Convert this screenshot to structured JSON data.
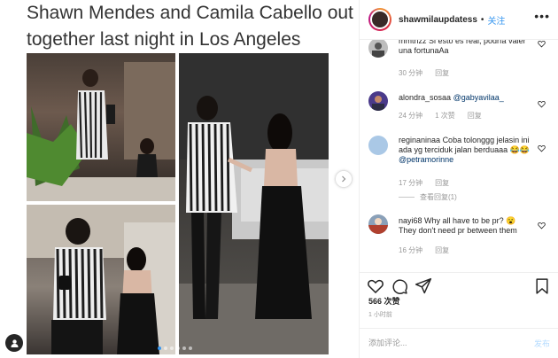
{
  "headline": "Shawn Mendes and Camila Cabello out together last night in Los Angeles",
  "header": {
    "username": "shawmilaupdatess",
    "separator": "•",
    "follow_label": "关注",
    "more_label": "•••"
  },
  "comments": [
    {
      "username": "mmtnzz",
      "text": "Si esto es real, podría valer una fortunaAa",
      "time": "30 分钟",
      "likes": "",
      "reply_label": "回复",
      "avatar_color": "#bdbdbd"
    },
    {
      "username": "alondra_sosaa",
      "mention": "@gabyavilaa_",
      "text": "",
      "time": "24 分钟",
      "likes": "1 次赞",
      "reply_label": "回复",
      "avatar_color": "#4a3a8a"
    },
    {
      "username": "reginaninaa",
      "text": "Coba tolonggg jelasin ini ada yg terciduk jalan berduaaa 😂😂",
      "mention": "@petramorinne",
      "time": "17 分钟",
      "likes": "",
      "reply_label": "回复",
      "view_replies": "查看回复(1)",
      "avatar_color": "#aac8e6"
    },
    {
      "username": "nayi68",
      "text": "Why all have to be pr? 😮 They don't need pr between them",
      "time": "16 分钟",
      "likes": "",
      "reply_label": "回复",
      "avatar_color": "#8aa0b8"
    }
  ],
  "likes_count": "566 次赞",
  "post_time": "1 小时前",
  "add_comment": {
    "placeholder": "添加评论...",
    "post_label": "发布"
  },
  "colors": {
    "accent": "#3897f0",
    "muted": "#999999",
    "border": "#efefef"
  },
  "carousel": {
    "slide_count": 6,
    "active_index": 0
  }
}
